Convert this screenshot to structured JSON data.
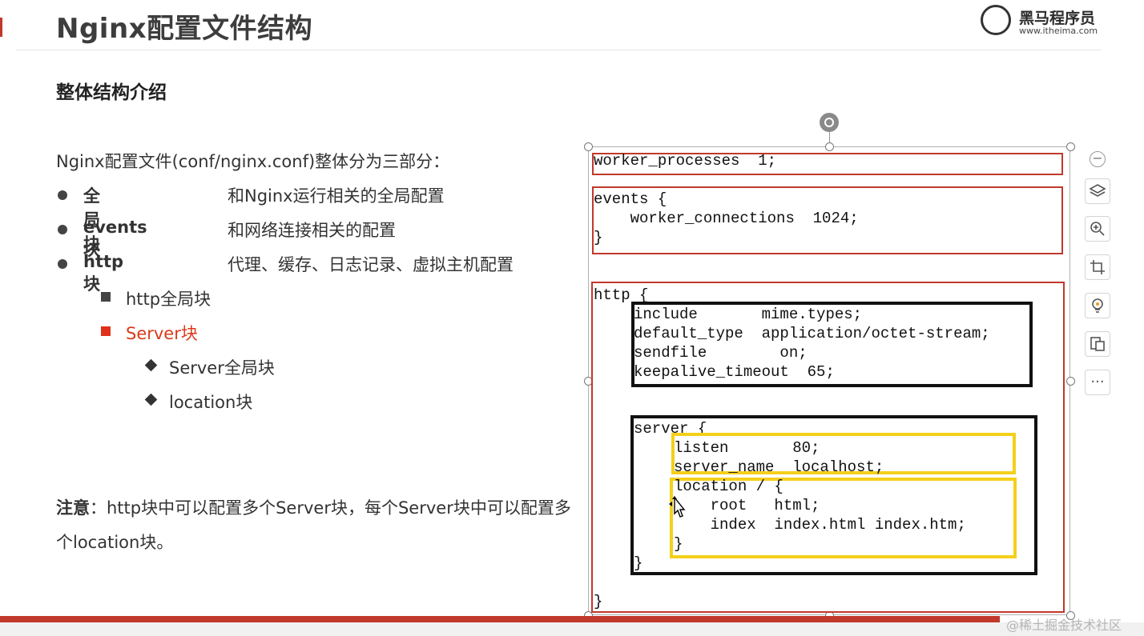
{
  "slide": {
    "title": "Nginx配置文件结构",
    "logo": {
      "name": "黑马程序员",
      "url": "www.itheima.com"
    },
    "section_title": "整体结构介绍",
    "intro": "Nginx配置文件(conf/nginx.conf)整体分为三部分：",
    "bullets": [
      {
        "name": "全局块",
        "desc": "和Nginx运行相关的全局配置"
      },
      {
        "name": "events块",
        "desc": "和网络连接相关的配置"
      },
      {
        "name": "http块",
        "desc": "代理、缓存、日志记录、虚拟主机配置"
      }
    ],
    "http_sub": [
      "http全局块",
      "Server块"
    ],
    "server_sub": [
      "Server全局块",
      "location块"
    ],
    "note_label": "注意",
    "note_text": "：http块中可以配置多个Server块，每个Server块中可以配置多个location块。"
  },
  "code": {
    "global": "worker_processes  1;",
    "events_open": "events {",
    "events_body": "    worker_connections  1024;",
    "events_close": "}",
    "http_open": "http {",
    "http_global": [
      "include       mime.types;",
      "default_type  application/octet-stream;",
      "sendfile        on;",
      "keepalive_timeout  65;"
    ],
    "server_open": "server {",
    "server_global": [
      "listen       80;",
      "server_name  localhost;"
    ],
    "location": [
      "location / {",
      "    root   html;",
      "    index  index.html index.htm;",
      "}"
    ],
    "server_close": "}",
    "http_close": "}"
  },
  "toolbar": {
    "items": [
      "zoom-out-icon",
      "layers-icon",
      "zoom-in-icon",
      "crop-icon",
      "idea-icon",
      "convert-icon"
    ],
    "more_label": "···"
  },
  "watermark": "@稀土掘金技术社区",
  "colors": {
    "accent_red": "#c0392b",
    "server_block_red": "#d93a1a",
    "highlight_yellow": "#f4d01a"
  }
}
